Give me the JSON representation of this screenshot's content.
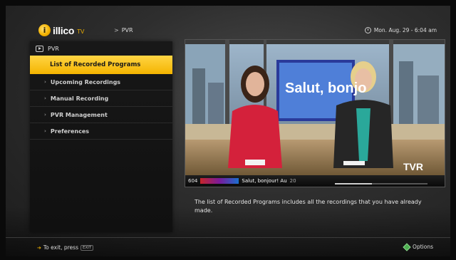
{
  "header": {
    "logo_text": "illico",
    "logo_suffix": "TV",
    "breadcrumb_separator": ">",
    "breadcrumb": "PVR",
    "datetime": "Mon. Aug. 29 - 6:04 am"
  },
  "sidebar": {
    "title": "PVR",
    "items": [
      {
        "label": "List of Recorded Programs",
        "active": true
      },
      {
        "label": "Upcoming Recordings",
        "active": false
      },
      {
        "label": "Manual Recording",
        "active": false
      },
      {
        "label": "PVR Management",
        "active": false
      },
      {
        "label": "Preferences",
        "active": false
      }
    ]
  },
  "preview": {
    "set_sign": "Salut, bonjo",
    "channel_logo": "TVR",
    "ticker_channel": "604",
    "ticker_title": "Salut, bonjour! Au",
    "ticker_extra": "20",
    "progress": 0.4
  },
  "description": "The list of Recorded Programs includes all the recordings that you have already made.",
  "footer": {
    "exit_hint": "To exit, press",
    "exit_key": "EXIT",
    "options_label": "Options"
  },
  "colors": {
    "accent": "#F4B400",
    "options_button": "#4CAF50"
  }
}
